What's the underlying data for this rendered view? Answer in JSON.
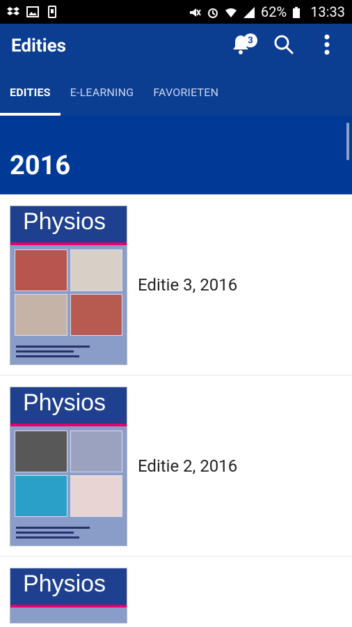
{
  "status_bar": {
    "battery": "62%",
    "time": "13:33"
  },
  "app_bar": {
    "title": "Edities",
    "notification_count": "3"
  },
  "tabs": [
    {
      "label": "EDITIES",
      "active": true
    },
    {
      "label": "E-LEARNING",
      "active": false
    },
    {
      "label": "FAVORIETEN",
      "active": false
    }
  ],
  "section": {
    "year": "2016"
  },
  "editions": [
    {
      "label": "Editie 3, 2016",
      "cover_title": "Physios"
    },
    {
      "label": "Editie 2, 2016",
      "cover_title": "Physios"
    },
    {
      "label": "",
      "cover_title": "Physios"
    }
  ],
  "colors": {
    "primary": "#0b3d91",
    "section": "#003a96",
    "accent": "#e6006e"
  }
}
